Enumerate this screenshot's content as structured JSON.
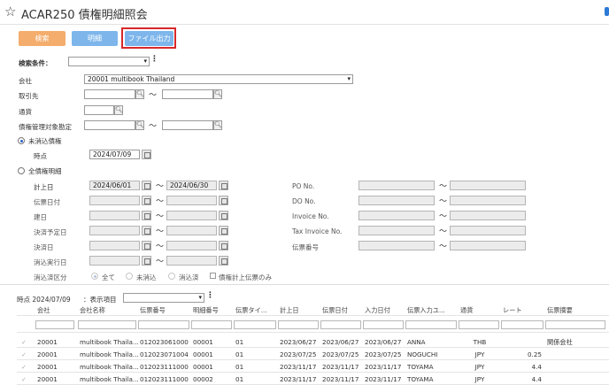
{
  "header": {
    "title": "ACAR250 債権明細照会"
  },
  "toolbar": {
    "search": "検索",
    "detail": "明細",
    "file_output": "ファイル出力"
  },
  "form": {
    "search_condition_label": "検索条件：",
    "company_label": "会社",
    "company_value": "20001 multibook Thailand",
    "partner_label": "取引先",
    "currency_label": "通貨",
    "target_label": "債権管理対象勘定",
    "uncleared_label": "未消込債権",
    "point_label": "時点",
    "point_value": "2024/07/09",
    "all_label": "全債権明細",
    "posting_date_label": "計上日",
    "posting_from": "2024/06/01",
    "posting_to": "2024/06/30",
    "slip_date_label": "伝票日付",
    "due_date_label": "建日",
    "settle_plan_label": "決済予定日",
    "settle_date_label": "決済日",
    "clear_exec_label": "消込実行日",
    "clear_type_label": "消込済区分",
    "opt_all": "全て",
    "opt_uncleared": "未消込",
    "opt_cleared": "消込済",
    "only_posted": "債権計上伝票のみ",
    "po_label": "PO No.",
    "do_label": "DO No.",
    "invoice_label": "Invoice No.",
    "tax_invoice_label": "Tax Invoice No.",
    "slip_no_label": "伝票番号",
    "tilde": "〜"
  },
  "results": {
    "point": "時点 2024/07/09",
    "display_items_label": "：表示項目",
    "columns": [
      "会社",
      "会社名称",
      "伝票番号",
      "明細番号",
      "伝票タイ...",
      "計上日",
      "伝票日付",
      "入力日付",
      "伝票入力ユ...",
      "通貨",
      "レート",
      "伝票摘要"
    ],
    "rows": [
      [
        "20001",
        "multibook Thaila...",
        "012023061000",
        "00001",
        "01",
        "2023/06/27",
        "2023/06/27",
        "2023/06/27",
        "ANNA",
        "THB",
        "",
        "関係会社"
      ],
      [
        "20001",
        "multibook Thaila...",
        "012023071004",
        "00001",
        "01",
        "2023/07/25",
        "2023/07/25",
        "2023/07/25",
        "NOGUCHI",
        "JPY",
        "0.25",
        ""
      ],
      [
        "20001",
        "multibook Thaila...",
        "012023111000",
        "00001",
        "01",
        "2023/11/17",
        "2023/11/17",
        "2023/11/17",
        "TOYAMA",
        "JPY",
        "4.4",
        ""
      ],
      [
        "20001",
        "multibook Thaila...",
        "012023111000",
        "00002",
        "01",
        "2023/11/17",
        "2023/11/17",
        "2023/11/17",
        "TOYAMA",
        "JPY",
        "4.4",
        ""
      ]
    ]
  },
  "colors": {
    "search_btn": "#f4ad6c",
    "detail_btn": "#7eb6ec",
    "highlight": "#d8282b"
  }
}
